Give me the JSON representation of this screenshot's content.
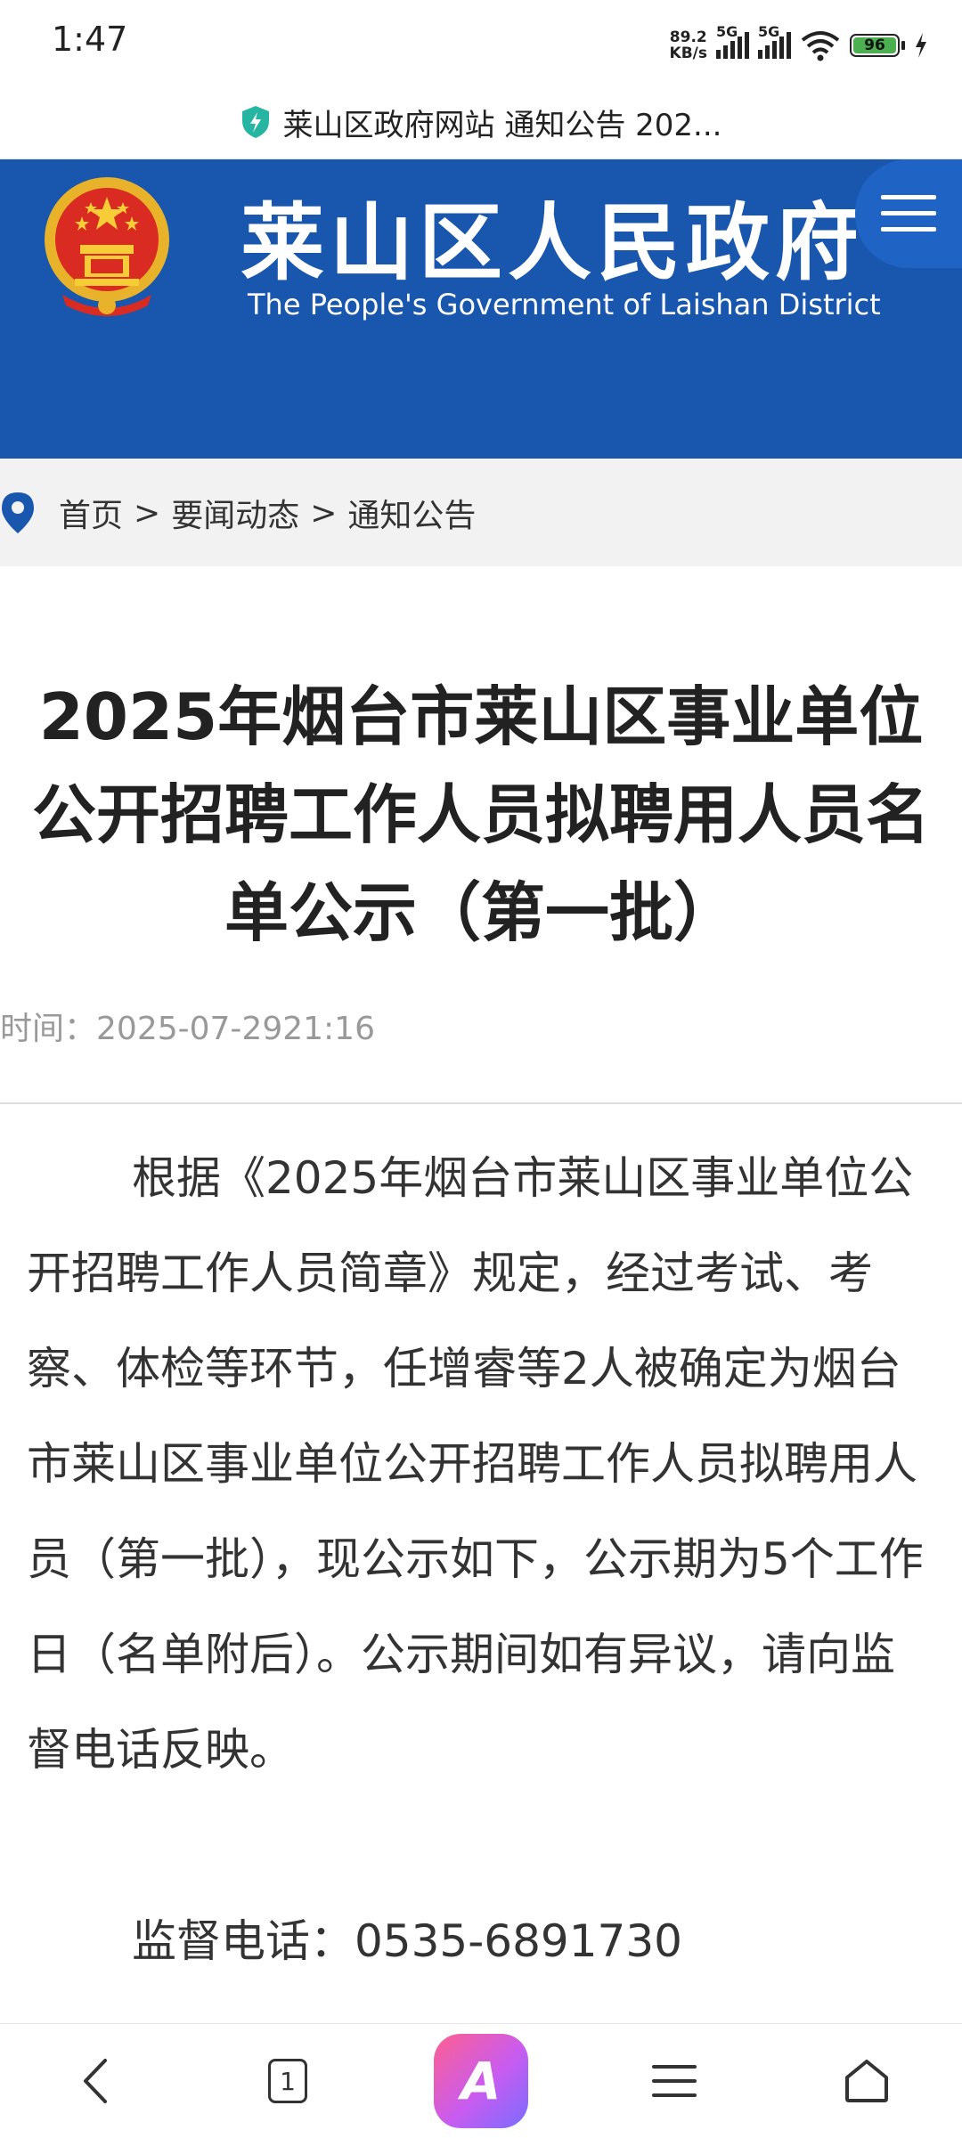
{
  "status_bar": {
    "time": "1:47",
    "net_speed": "89.2",
    "net_unit": "KB/s",
    "sim1_label": "5G",
    "sim2_label": "5G",
    "battery": "96"
  },
  "url_bar": {
    "title": "莱山区政府网站 通知公告 202...",
    "icon": "shield-lightning-icon"
  },
  "header": {
    "title_cn": "莱山区人民政府",
    "title_en": "The People's Government of Laishan District",
    "colors": {
      "banner": "#1857ad",
      "accent": "#1f63c4"
    }
  },
  "breadcrumb": {
    "items": [
      "首页",
      "要闻动态",
      "通知公告"
    ],
    "separator": ">"
  },
  "article": {
    "title_lines": [
      "2025年烟台市莱山区事业单位",
      "公开招聘工作人员拟聘用人员名",
      "单公示（第一批）"
    ],
    "time_label": "时间：",
    "time_value": "2025-07-2921:16",
    "body": "根据《2025年烟台市莱山区事业单位公开招聘工作人员简章》规定，经过考试、考察、体检等环节，任增睿等2人被确定为烟台市莱山区事业单位公开招聘工作人员拟聘用人员（第一批），现公示如下，公示期为5个工作日（名单附后）。公示期间如有异议，请向监督电话反映。",
    "phone_label": "监督电话：",
    "phone_value": "0535-6891730"
  },
  "bottom_nav": {
    "tab_count": "1",
    "ai_label": "A"
  }
}
